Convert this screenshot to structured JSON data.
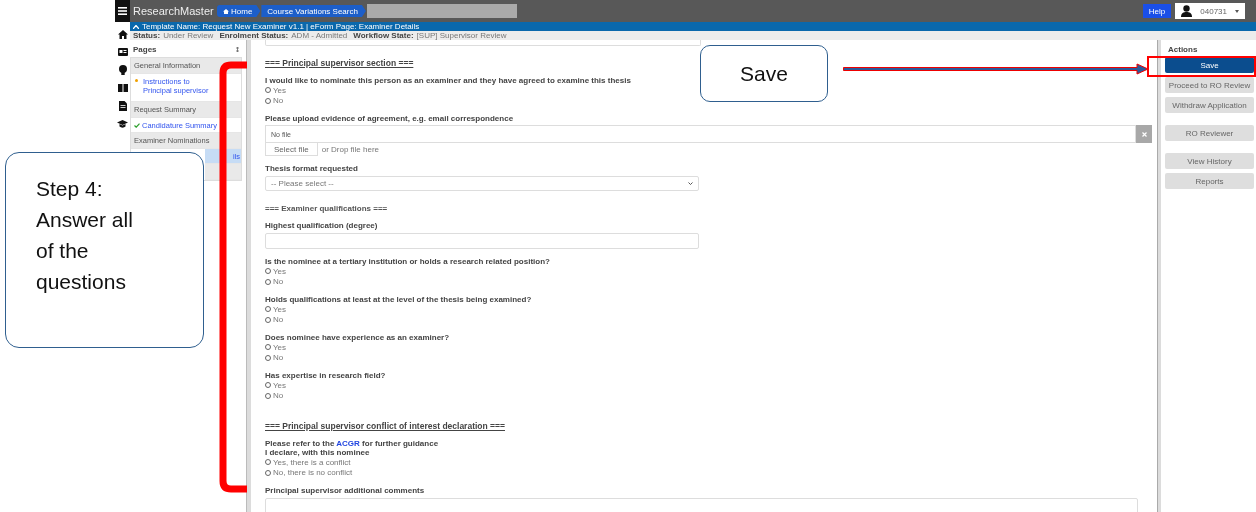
{
  "app": {
    "title": "ResearchMaster"
  },
  "breadcrumbs": [
    {
      "label": "Home",
      "kind": "home"
    },
    {
      "label": "Course Variations Search",
      "kind": "page"
    }
  ],
  "help": "Help",
  "user": "040731",
  "template_bar": "Template Name: Request New Examiner v1.1 | eForm Page: Examiner Details",
  "status": [
    {
      "label": "Status:",
      "value": "Under Review"
    },
    {
      "label": "Enrolment Status:",
      "value": "ADM - Admitted"
    },
    {
      "label": "Workflow State:",
      "value": "[SUP] Supervisor Review"
    }
  ],
  "pages": {
    "title": "Pages",
    "items": [
      {
        "label": "General Information",
        "kind": "header",
        "selected": false
      },
      {
        "label": "Instructions to Principal supervisor",
        "kind": "current",
        "selected": false
      },
      {
        "label": "Request Summary",
        "kind": "header",
        "selected": false
      },
      {
        "label": "Candidature Summary",
        "kind": "done",
        "selected": false
      },
      {
        "label": "Examiner Nominations",
        "kind": "header",
        "selected": false
      },
      {
        "label": "ils",
        "kind": "link",
        "selected": true
      },
      {
        "kind": "header",
        "selected": false
      }
    ]
  },
  "form": [
    {
      "kind": "top-input"
    },
    {
      "kind": "heading",
      "label": "=== Principal supervisor section ==="
    },
    {
      "kind": "radio",
      "label": "I would like to nominate this person as an examiner and they have agreed to examine this thesis",
      "options": [
        {
          "label": "Yes",
          "selected": false
        },
        {
          "label": "No",
          "selected": false
        }
      ]
    },
    {
      "kind": "file",
      "label": "Please upload evidence of agreement, e.g. email correspondence",
      "value": "No file",
      "button": "Select file",
      "hint": "or Drop file here"
    },
    {
      "kind": "select",
      "label": "Thesis format requested",
      "placeholder": "-- Please select --"
    },
    {
      "kind": "subheading",
      "label": "=== Examiner qualifications ==="
    },
    {
      "kind": "text",
      "label": "Highest qualification (degree)"
    },
    {
      "kind": "radio",
      "label": "Is the nominee at a tertiary institution or holds a research related position?",
      "options": [
        {
          "label": "Yes",
          "selected": false
        },
        {
          "label": "No",
          "selected": false
        }
      ]
    },
    {
      "kind": "radio",
      "label": "Holds qualifications at least at the level of the thesis being examined?",
      "options": [
        {
          "label": "Yes",
          "selected": false
        },
        {
          "label": "No",
          "selected": false
        }
      ]
    },
    {
      "kind": "radio",
      "label": "Does nominee have experience as an examiner?",
      "options": [
        {
          "label": "Yes",
          "selected": false
        },
        {
          "label": "No",
          "selected": false
        }
      ]
    },
    {
      "kind": "radio",
      "label": "Has expertise in research field?",
      "options": [
        {
          "label": "Yes",
          "selected": false
        },
        {
          "label": "No",
          "selected": false
        }
      ]
    },
    {
      "kind": "heading",
      "label": "=== Principal supervisor conflict of interest declaration ==="
    },
    {
      "kind": "note",
      "before": "Please refer to the",
      "link": "ACGR",
      "after": "for further guidance"
    },
    {
      "kind": "radio",
      "label": "I declare, with this nominee",
      "options": [
        {
          "label": "Yes, there is a conflict",
          "selected": false
        },
        {
          "label": "No, there is no conflict",
          "selected": false
        }
      ]
    },
    {
      "kind": "comment",
      "label": "Principal supervisor additional comments"
    }
  ],
  "actions": {
    "title": "Actions",
    "groups": [
      [
        {
          "label": "Save",
          "primary": true
        },
        {
          "label": "Proceed to RO Review",
          "primary": false
        },
        {
          "label": "Withdraw Application",
          "primary": false
        }
      ],
      [
        {
          "label": "RO Reviewer",
          "primary": false
        }
      ],
      [
        {
          "label": "View History",
          "primary": false
        },
        {
          "label": "Reports",
          "primary": false
        }
      ]
    ]
  },
  "annotations": {
    "step": "Step 4: Answer all of the questions",
    "save": "Save"
  }
}
